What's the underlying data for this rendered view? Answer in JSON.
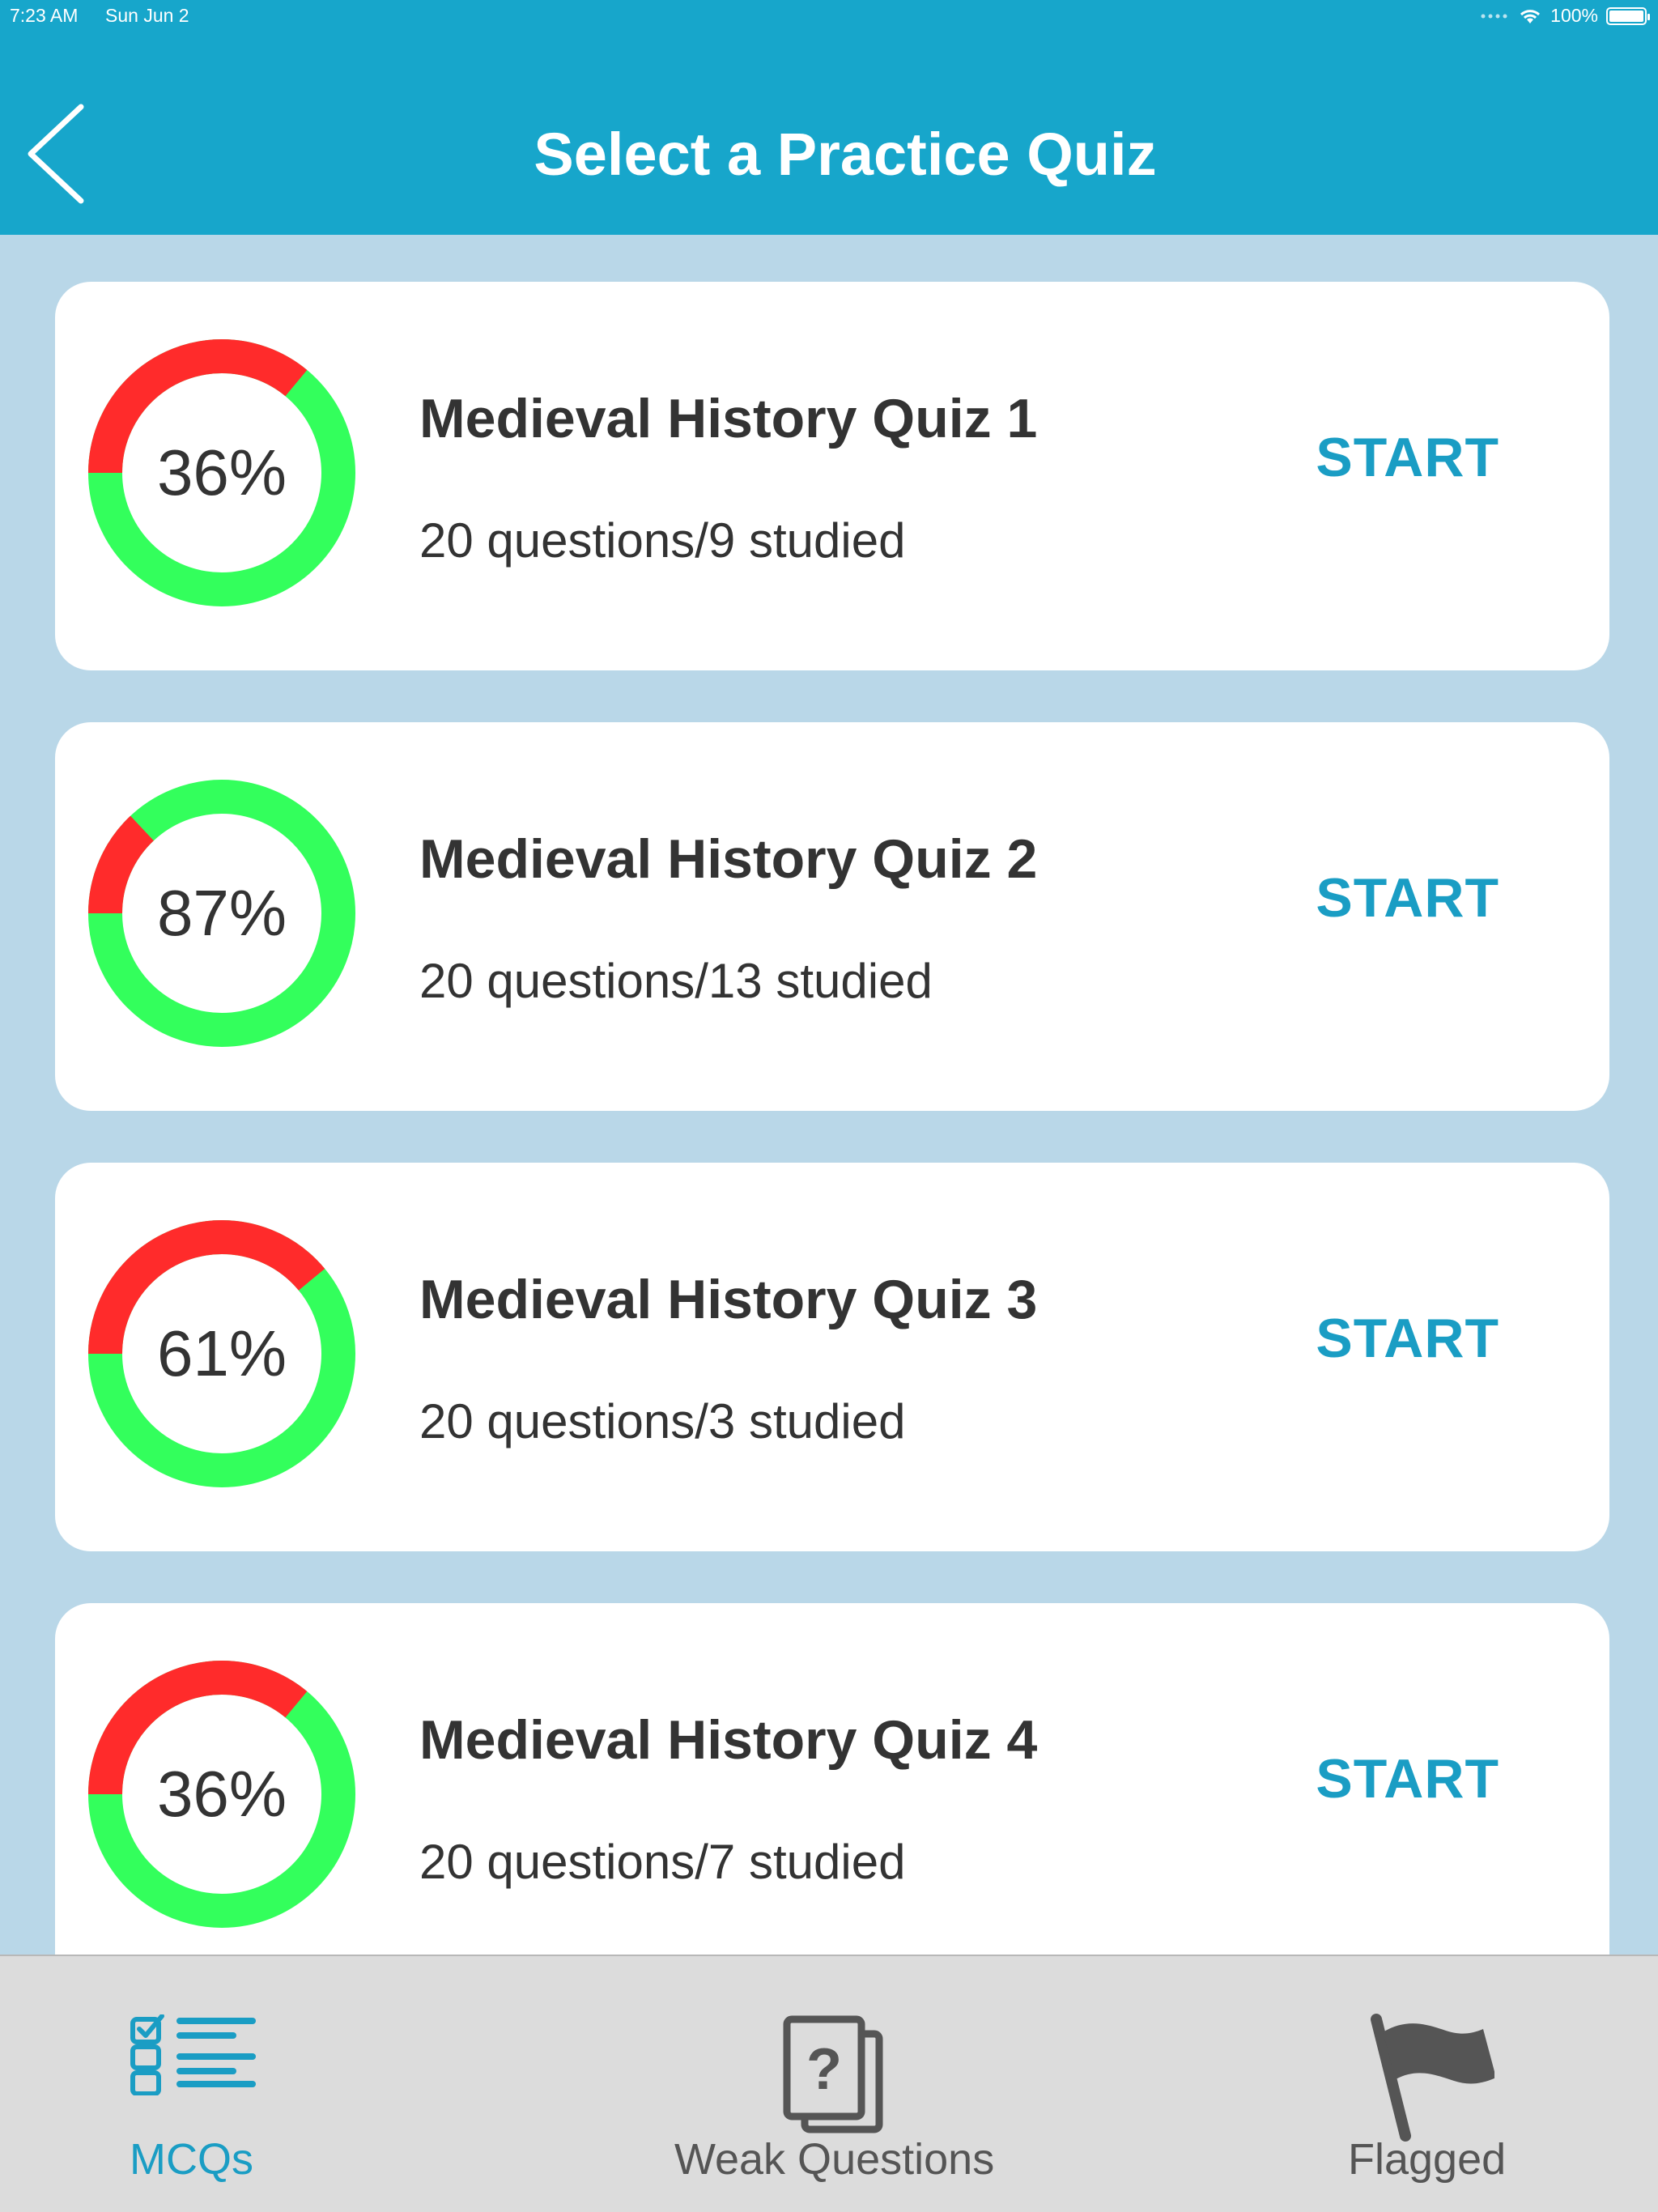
{
  "status": {
    "time": "7:23 AM",
    "date": "Sun Jun 2",
    "battery": "100%"
  },
  "header": {
    "title": "Select a Practice Quiz",
    "back_icon": "chevron-left-icon"
  },
  "colors": {
    "primary": "#17a6cb",
    "background": "#b9d7e8",
    "correct": "#33ff5c",
    "incorrect": "#ff2b2b",
    "start_text": "#1a9dc4"
  },
  "quizzes": [
    {
      "title": "Medieval History Quiz 1",
      "subtitle": "20 questions/9 studied",
      "percent_label": "36%",
      "red_fraction": 0.36,
      "start": "START"
    },
    {
      "title": "Medieval History Quiz 2",
      "subtitle": "20 questions/13 studied",
      "percent_label": "87%",
      "red_fraction": 0.13,
      "start": "START"
    },
    {
      "title": "Medieval History Quiz 3",
      "subtitle": "20 questions/3 studied",
      "percent_label": "61%",
      "red_fraction": 0.39,
      "start": "START"
    },
    {
      "title": "Medieval History Quiz 4",
      "subtitle": "20 questions/7 studied",
      "percent_label": "36%",
      "red_fraction": 0.36,
      "start": "START"
    }
  ],
  "tabs": [
    {
      "label": "MCQs",
      "icon": "checklist-icon",
      "active": true
    },
    {
      "label": "Weak Questions",
      "icon": "question-cards-icon",
      "active": false
    },
    {
      "label": "Flagged",
      "icon": "flag-icon",
      "active": false
    }
  ]
}
